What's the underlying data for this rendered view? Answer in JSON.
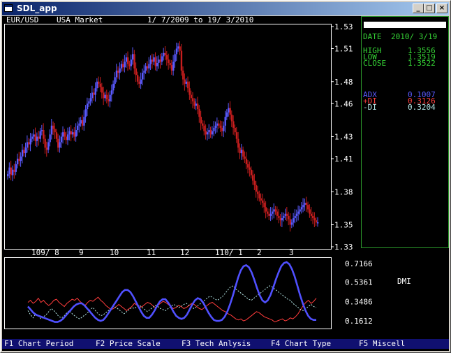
{
  "window": {
    "title": "SDL_app",
    "buttons": [
      "_",
      "□",
      "×"
    ]
  },
  "chart_header": {
    "pair": "EUR/USD",
    "market": "USA Market",
    "range": "1/ 7/2009  to 19/ 3/2010"
  },
  "side": {
    "date_label": "DATE",
    "date_value": "2010/ 3/19",
    "high_label": "HIGH",
    "high_value": "1.3556",
    "low_label": "LOW",
    "low_value": "1.3519",
    "close_label": "CLOSE",
    "close_value": "1.3522",
    "adx_label": "ADX",
    "adx_value": "0.1007",
    "pdi_label": "+DI",
    "pdi_value": "0.3126",
    "mdi_label": "-DI",
    "mdi_value": "0.3204"
  },
  "indicator": {
    "name": "DMI"
  },
  "colors": {
    "candle_up": "#5a5aff",
    "candle_down": "#c81e1e",
    "adx": "#5050ff",
    "pdi": "#ff3c3c",
    "mdi": "#b4e6e6",
    "panel_border": "#2c9a2c",
    "fn_bar": "#101070"
  },
  "fn_keys": [
    "F1 Chart Period",
    "F2 Price Scale",
    "F3 Tech Anlysis",
    "F4 Chart Type",
    "F5 Miscell"
  ],
  "chart_data": [
    {
      "type": "candlestick",
      "title": "EUR/USD  USA Market  1/ 7/2009  to 19/ 3/2010",
      "x_tick_labels": [
        "109/ 8",
        "9",
        "10",
        "11",
        "12",
        "110/ 1",
        "2",
        "3"
      ],
      "y_ticks": [
        1.33,
        1.35,
        1.38,
        1.41,
        1.43,
        1.46,
        1.48,
        1.51,
        1.53
      ],
      "ylim": [
        1.33,
        1.53
      ],
      "series": [
        {
          "name": "price",
          "close": [
            1.396,
            1.402,
            1.395,
            1.4,
            1.398,
            1.405,
            1.41,
            1.408,
            1.412,
            1.418,
            1.415,
            1.42,
            1.425,
            1.423,
            1.428,
            1.43,
            1.432,
            1.426,
            1.43,
            1.428,
            1.435,
            1.436,
            1.428,
            1.42,
            1.418,
            1.425,
            1.432,
            1.44,
            1.437,
            1.434,
            1.428,
            1.42,
            1.425,
            1.43,
            1.434,
            1.43,
            1.427,
            1.432,
            1.435,
            1.432,
            1.434,
            1.43,
            1.436,
            1.44,
            1.442,
            1.445,
            1.44,
            1.448,
            1.455,
            1.46,
            1.462,
            1.465,
            1.47,
            1.468,
            1.474,
            1.48,
            1.478,
            1.475,
            1.47,
            1.465,
            1.468,
            1.464,
            1.462,
            1.468,
            1.472,
            1.478,
            1.484,
            1.49,
            1.488,
            1.492,
            1.496,
            1.493,
            1.498,
            1.502,
            1.496,
            1.494,
            1.5,
            1.505,
            1.492,
            1.486,
            1.48,
            1.478,
            1.482,
            1.488,
            1.49,
            1.494,
            1.492,
            1.496,
            1.5,
            1.498,
            1.502,
            1.494,
            1.497,
            1.5,
            1.498,
            1.503,
            1.506,
            1.504,
            1.5,
            1.497,
            1.495,
            1.49,
            1.498,
            1.505,
            1.51,
            1.512,
            1.508,
            1.49,
            1.482,
            1.478,
            1.48,
            1.474,
            1.468,
            1.465,
            1.462,
            1.458,
            1.46,
            1.455,
            1.448,
            1.442,
            1.44,
            1.435,
            1.432,
            1.434,
            1.436,
            1.432,
            1.435,
            1.438,
            1.44,
            1.442,
            1.44,
            1.438,
            1.435,
            1.44,
            1.448,
            1.452,
            1.456,
            1.45,
            1.444,
            1.438,
            1.434,
            1.428,
            1.42,
            1.415,
            1.418,
            1.412,
            1.41,
            1.405,
            1.402,
            1.4,
            1.395,
            1.39,
            1.386,
            1.38,
            1.378,
            1.374,
            1.372,
            1.37,
            1.366,
            1.362,
            1.36,
            1.358,
            1.36,
            1.362,
            1.364,
            1.362,
            1.358,
            1.356,
            1.354,
            1.356,
            1.358,
            1.36,
            1.358,
            1.355,
            1.35,
            1.352,
            1.356,
            1.358,
            1.36,
            1.362,
            1.364,
            1.366,
            1.368,
            1.37,
            1.368,
            1.364,
            1.36,
            1.358,
            1.356,
            1.354,
            1.352,
            1.3522
          ]
        }
      ]
    },
    {
      "type": "line",
      "title": "DMI",
      "y_ticks": [
        0.1612,
        0.3486,
        0.5361,
        0.7166
      ],
      "ylim": [
        0.1,
        0.75
      ],
      "series": [
        {
          "name": "ADX",
          "values": [
            0.3,
            0.27,
            0.24,
            0.22,
            0.21,
            0.2,
            0.19,
            0.18,
            0.17,
            0.16,
            0.15,
            0.15,
            0.16,
            0.18,
            0.21,
            0.24,
            0.27,
            0.3,
            0.32,
            0.33,
            0.33,
            0.31,
            0.28,
            0.25,
            0.22,
            0.19,
            0.17,
            0.16,
            0.17,
            0.2,
            0.24,
            0.28,
            0.32,
            0.36,
            0.4,
            0.44,
            0.46,
            0.46,
            0.44,
            0.4,
            0.35,
            0.3,
            0.25,
            0.21,
            0.19,
            0.19,
            0.22,
            0.26,
            0.31,
            0.35,
            0.37,
            0.37,
            0.34,
            0.3,
            0.25,
            0.21,
            0.19,
            0.18,
            0.19,
            0.22,
            0.27,
            0.32,
            0.36,
            0.38,
            0.37,
            0.34,
            0.29,
            0.24,
            0.2,
            0.17,
            0.16,
            0.16,
            0.17,
            0.2,
            0.25,
            0.32,
            0.4,
            0.49,
            0.58,
            0.65,
            0.69,
            0.7,
            0.68,
            0.63,
            0.56,
            0.48,
            0.41,
            0.36,
            0.34,
            0.36,
            0.41,
            0.48,
            0.56,
            0.63,
            0.69,
            0.72,
            0.73,
            0.71,
            0.66,
            0.59,
            0.5,
            0.41,
            0.33,
            0.26,
            0.21,
            0.18,
            0.17,
            0.17
          ]
        },
        {
          "name": "+DI",
          "values": [
            0.34,
            0.36,
            0.33,
            0.35,
            0.38,
            0.34,
            0.36,
            0.33,
            0.31,
            0.33,
            0.36,
            0.37,
            0.34,
            0.32,
            0.3,
            0.33,
            0.35,
            0.37,
            0.36,
            0.38,
            0.35,
            0.33,
            0.31,
            0.34,
            0.36,
            0.35,
            0.37,
            0.39,
            0.36,
            0.34,
            0.31,
            0.29,
            0.27,
            0.28,
            0.3,
            0.32,
            0.3,
            0.28,
            0.26,
            0.28,
            0.3,
            0.33,
            0.31,
            0.29,
            0.3,
            0.32,
            0.34,
            0.33,
            0.31,
            0.29,
            0.31,
            0.33,
            0.35,
            0.34,
            0.32,
            0.3,
            0.28,
            0.29,
            0.31,
            0.3,
            0.28,
            0.29,
            0.31,
            0.33,
            0.32,
            0.3,
            0.28,
            0.27,
            0.29,
            0.31,
            0.33,
            0.34,
            0.32,
            0.3,
            0.28,
            0.26,
            0.25,
            0.23,
            0.22,
            0.2,
            0.18,
            0.17,
            0.18,
            0.16,
            0.17,
            0.19,
            0.21,
            0.23,
            0.25,
            0.24,
            0.22,
            0.2,
            0.19,
            0.18,
            0.17,
            0.15,
            0.16,
            0.17,
            0.18,
            0.16,
            0.17,
            0.19,
            0.18,
            0.2,
            0.23,
            0.27,
            0.31,
            0.34,
            0.36,
            0.33,
            0.35,
            0.38
          ]
        },
        {
          "name": "-DI",
          "values": [
            0.26,
            0.22,
            0.19,
            0.23,
            0.21,
            0.18,
            0.2,
            0.22,
            0.25,
            0.28,
            0.26,
            0.23,
            0.2,
            0.19,
            0.21,
            0.24,
            0.26,
            0.23,
            0.21,
            0.19,
            0.18,
            0.2,
            0.22,
            0.24,
            0.27,
            0.29,
            0.26,
            0.23,
            0.21,
            0.22,
            0.24,
            0.26,
            0.28,
            0.3,
            0.29,
            0.27,
            0.25,
            0.23,
            0.25,
            0.27,
            0.29,
            0.28,
            0.3,
            0.31,
            0.29,
            0.27,
            0.25,
            0.27,
            0.29,
            0.31,
            0.3,
            0.28,
            0.27,
            0.26,
            0.28,
            0.3,
            0.32,
            0.31,
            0.29,
            0.3,
            0.32,
            0.33,
            0.31,
            0.29,
            0.28,
            0.3,
            0.32,
            0.34,
            0.36,
            0.38,
            0.4,
            0.39,
            0.37,
            0.36,
            0.38,
            0.4,
            0.43,
            0.46,
            0.49,
            0.5,
            0.47,
            0.45,
            0.43,
            0.41,
            0.39,
            0.37,
            0.36,
            0.38,
            0.4,
            0.42,
            0.44,
            0.46,
            0.48,
            0.5,
            0.49,
            0.47,
            0.45,
            0.43,
            0.41,
            0.39,
            0.37,
            0.36,
            0.33,
            0.31,
            0.29,
            0.27,
            0.26,
            0.28,
            0.3,
            0.32,
            0.3,
            0.29
          ]
        }
      ]
    }
  ]
}
